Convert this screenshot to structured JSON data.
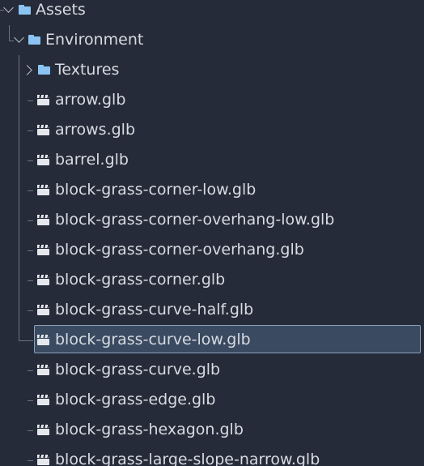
{
  "tree": {
    "root_folder": {
      "label": "Assets",
      "icon": "folder-icon",
      "expanded": true
    },
    "sub_folder": {
      "label": "Environment",
      "icon": "folder-icon",
      "expanded": true
    },
    "items": [
      {
        "label": "Textures",
        "icon": "folder-icon",
        "type": "folder",
        "expanded": false
      },
      {
        "label": "arrow.glb",
        "icon": "scene-icon",
        "type": "file"
      },
      {
        "label": "arrows.glb",
        "icon": "scene-icon",
        "type": "file"
      },
      {
        "label": "barrel.glb",
        "icon": "scene-icon",
        "type": "file"
      },
      {
        "label": "block-grass-corner-low.glb",
        "icon": "scene-icon",
        "type": "file"
      },
      {
        "label": "block-grass-corner-overhang-low.glb",
        "icon": "scene-icon",
        "type": "file"
      },
      {
        "label": "block-grass-corner-overhang.glb",
        "icon": "scene-icon",
        "type": "file"
      },
      {
        "label": "block-grass-corner.glb",
        "icon": "scene-icon",
        "type": "file"
      },
      {
        "label": "block-grass-curve-half.glb",
        "icon": "scene-icon",
        "type": "file"
      },
      {
        "label": "block-grass-curve-low.glb",
        "icon": "scene-icon",
        "type": "file",
        "selected": true
      },
      {
        "label": "block-grass-curve.glb",
        "icon": "scene-icon",
        "type": "file"
      },
      {
        "label": "block-grass-edge.glb",
        "icon": "scene-icon",
        "type": "file"
      },
      {
        "label": "block-grass-hexagon.glb",
        "icon": "scene-icon",
        "type": "file"
      },
      {
        "label": "block-grass-large-slope-narrow.glb",
        "icon": "scene-icon",
        "type": "file"
      }
    ]
  },
  "colors": {
    "background": "#252b38",
    "text": "#d7dbe2",
    "folder": "#8bc4f2",
    "selection_bg": "#3a4a60",
    "selection_border": "#8aa0bd",
    "guide_line": "#6d7380"
  }
}
